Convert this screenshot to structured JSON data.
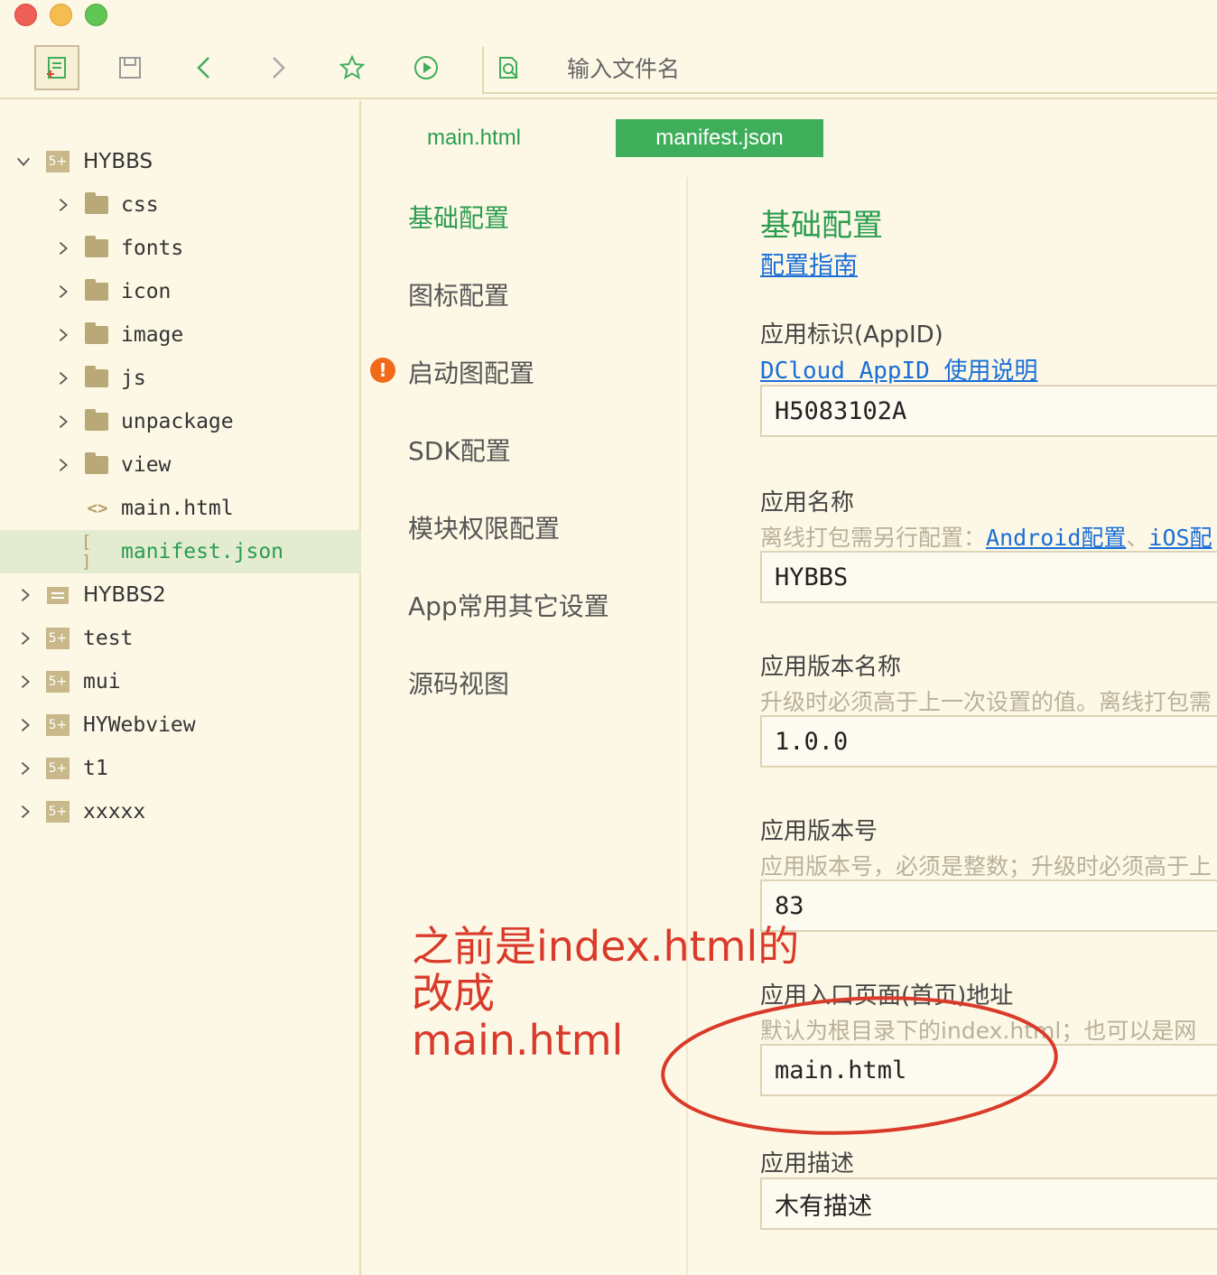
{
  "search": {
    "placeholder": "输入文件名"
  },
  "tree": [
    {
      "label": "HYBBS",
      "type": "project",
      "icon": "5+",
      "expanded": true
    },
    {
      "label": "css",
      "type": "folder"
    },
    {
      "label": "fonts",
      "type": "folder"
    },
    {
      "label": "icon",
      "type": "folder"
    },
    {
      "label": "image",
      "type": "folder"
    },
    {
      "label": "js",
      "type": "folder"
    },
    {
      "label": "unpackage",
      "type": "folder"
    },
    {
      "label": "view",
      "type": "folder"
    },
    {
      "label": "main.html",
      "type": "file",
      "icon": "<>"
    },
    {
      "label": "manifest.json",
      "type": "file",
      "icon": "[ ]",
      "selected": true
    },
    {
      "label": "HYBBS2",
      "type": "project",
      "icon": "list"
    },
    {
      "label": "test",
      "type": "project",
      "icon": "5+"
    },
    {
      "label": "mui",
      "type": "project",
      "icon": "5+"
    },
    {
      "label": "HYWebview",
      "type": "project",
      "icon": "5+"
    },
    {
      "label": "t1",
      "type": "project",
      "icon": "5+"
    },
    {
      "label": "xxxxx",
      "type": "project",
      "icon": "5+"
    }
  ],
  "tabs": [
    {
      "label": "main.html",
      "active": false
    },
    {
      "label": "manifest.json",
      "active": true
    }
  ],
  "config_nav": [
    {
      "label": "基础配置",
      "active": true
    },
    {
      "label": "图标配置"
    },
    {
      "label": "启动图配置",
      "warning": "!"
    },
    {
      "label": "SDK配置"
    },
    {
      "label": "模块权限配置"
    },
    {
      "label": "App常用其它设置"
    },
    {
      "label": "源码视图"
    }
  ],
  "content": {
    "title": "基础配置",
    "guide_link": "配置指南",
    "appid": {
      "label": "应用标识(AppID)",
      "link_a": "DCloud AppID",
      "link_b": "使用说明",
      "value": "H5083102A"
    },
    "name": {
      "label": "应用名称",
      "hint": "离线打包需另行配置：",
      "link_android": "Android配置",
      "sep": "、",
      "link_ios": "iOS配",
      "value": "HYBBS"
    },
    "version_name": {
      "label": "应用版本名称",
      "hint": "升级时必须高于上一次设置的值。离线打包需",
      "value": "1.0.0"
    },
    "version_code": {
      "label": "应用版本号",
      "hint": "应用版本号，必须是整数；升级时必须高于上",
      "value": "83"
    },
    "entry": {
      "label": "应用入口页面(首页)地址",
      "hint": "默认为根目录下的index.html；也可以是网",
      "value": "main.html"
    },
    "description": {
      "label": "应用描述",
      "value": "木有描述"
    }
  },
  "annotation": {
    "line1": "之前是index.html的",
    "line2": "改成",
    "line3": "main.html",
    "color": "#d93a2a"
  },
  "colors": {
    "accent": "#2a9d50",
    "tab_active_bg": "#3fae5a",
    "link": "#1a6ed8",
    "warning": "#f06a1a"
  }
}
